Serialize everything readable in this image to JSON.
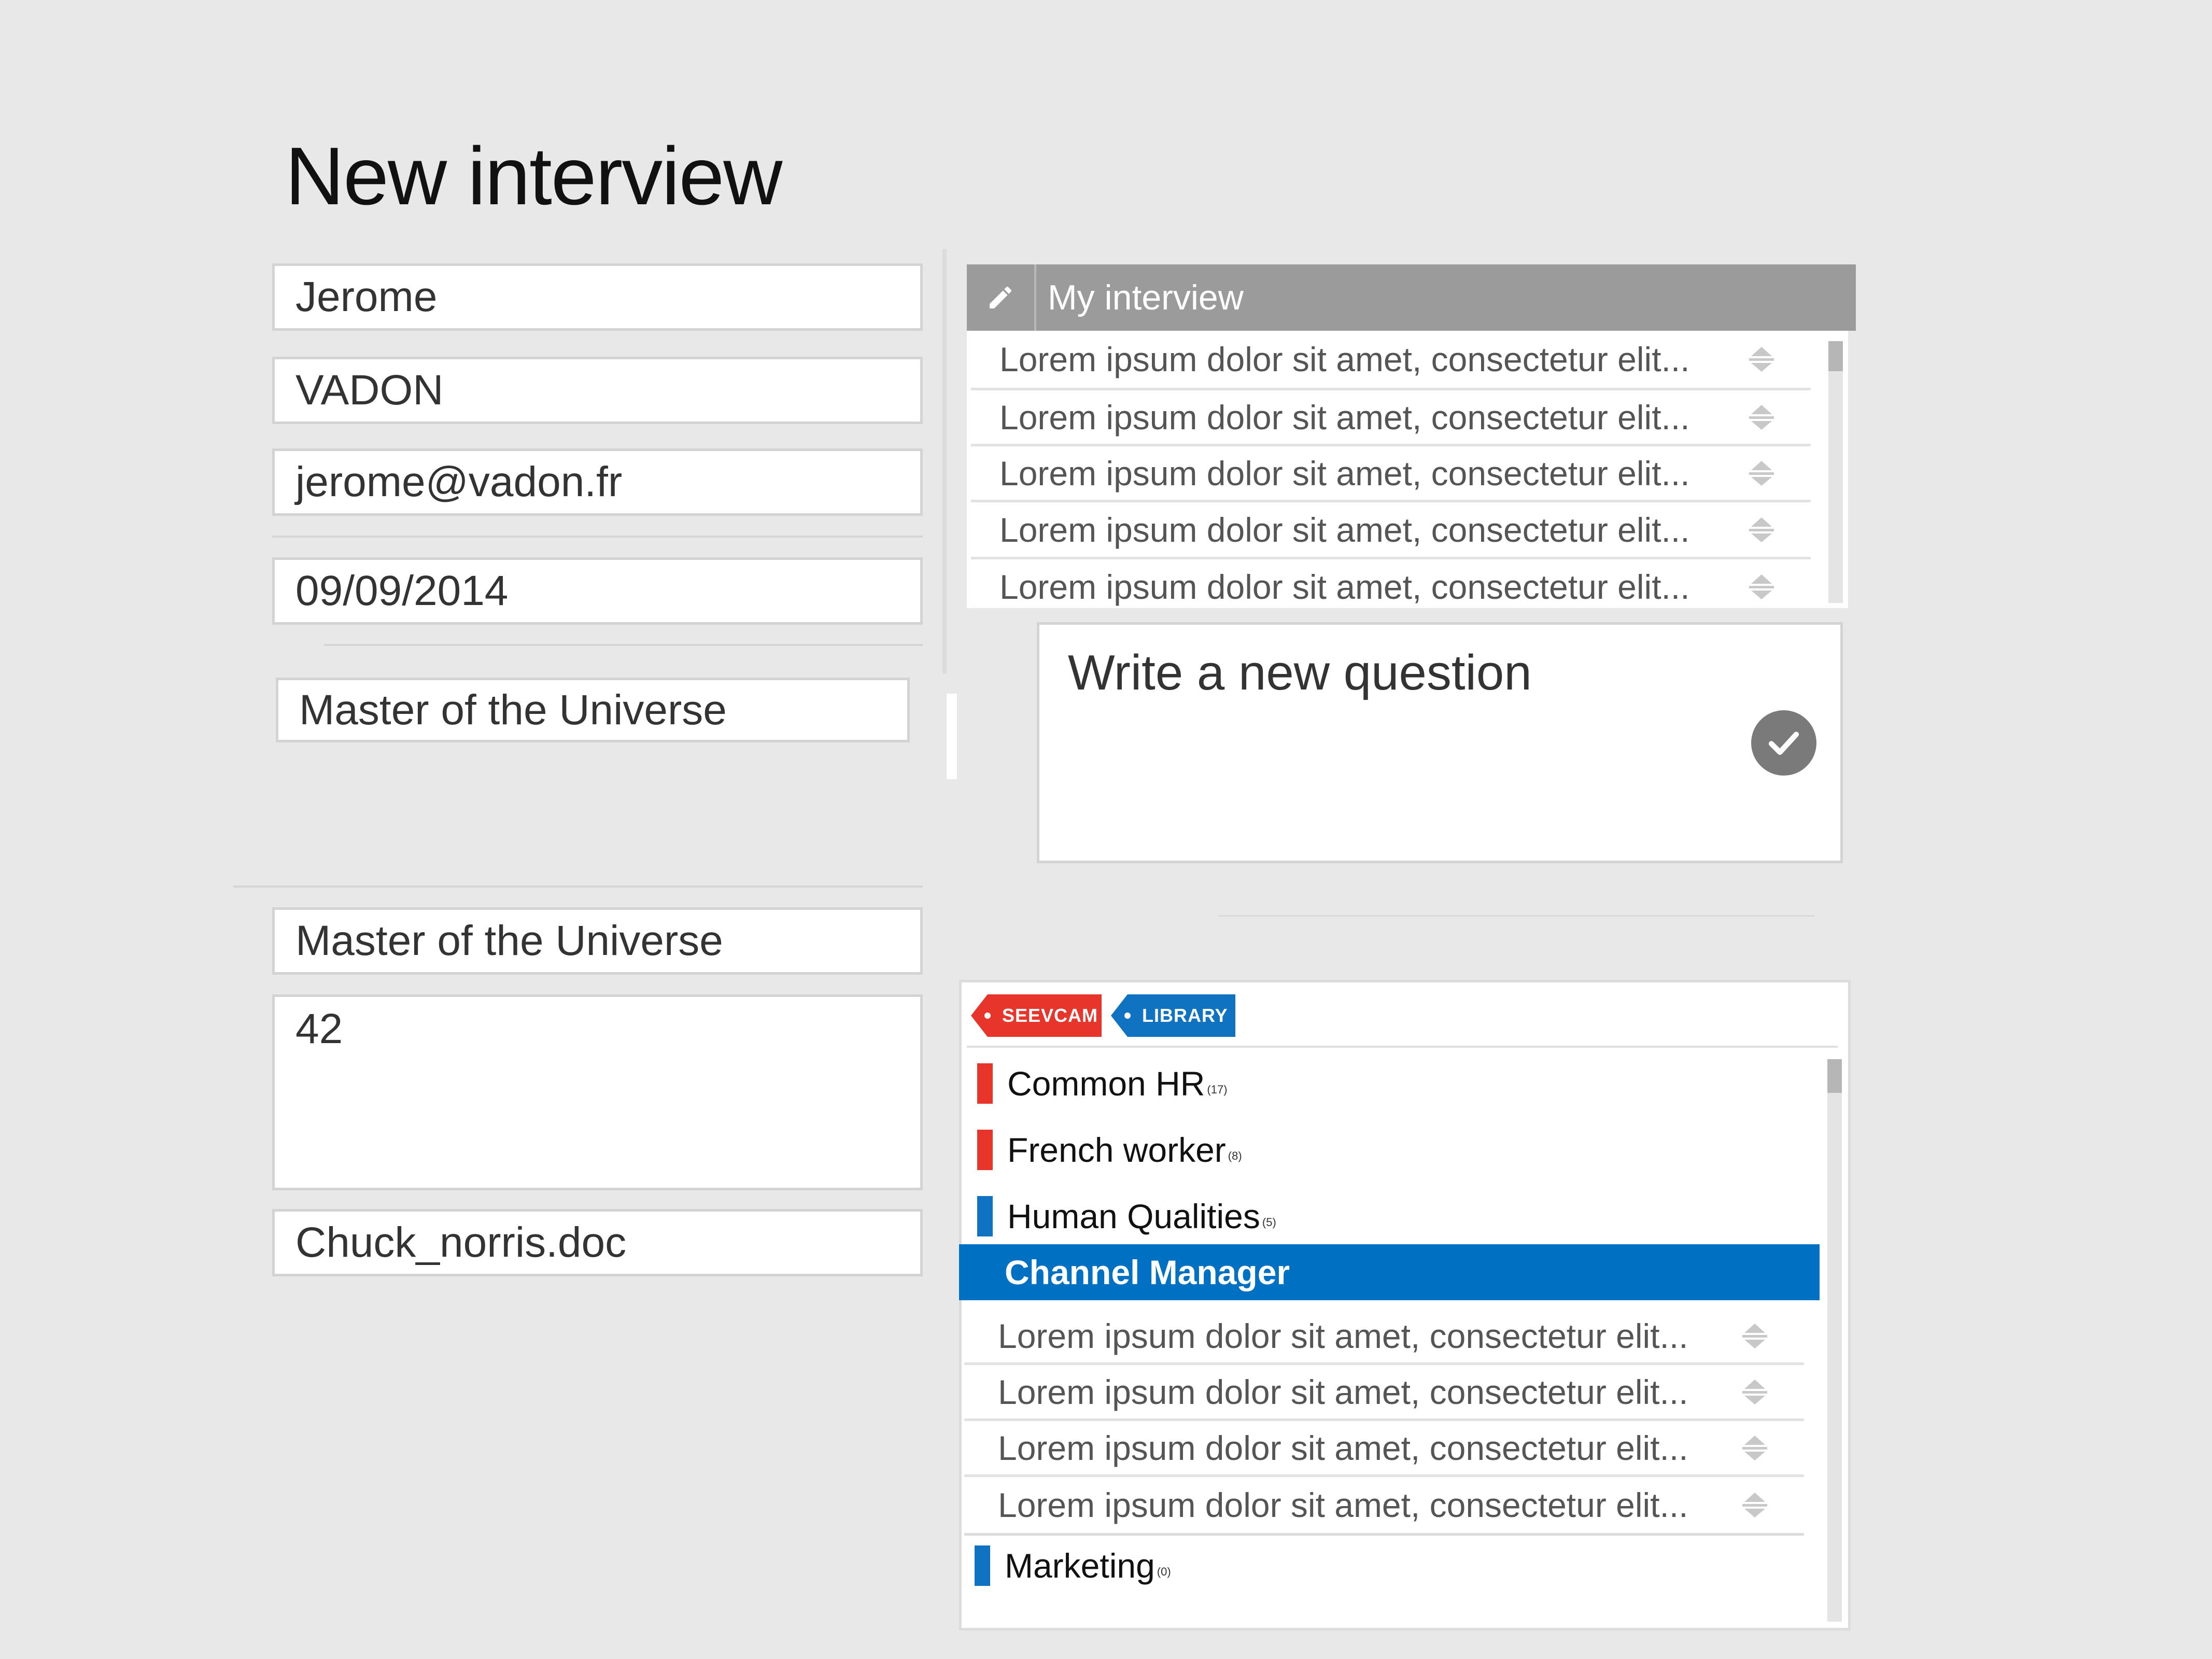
{
  "page": {
    "title": "New interview"
  },
  "form": {
    "first_name": "Jerome",
    "last_name": "VADON",
    "email": "jerome@vadon.fr",
    "date": "09/09/2014",
    "position": "Master of the Universe",
    "position_2": "Master of the Universe",
    "notes": "42",
    "attachment": "Chuck_norris.doc"
  },
  "interview_panel": {
    "title": "My interview",
    "questions": [
      "Lorem ipsum dolor sit amet, consectetur elit...",
      "Lorem ipsum dolor sit amet, consectetur elit...",
      "Lorem ipsum dolor sit amet, consectetur elit...",
      "Lorem ipsum dolor sit amet, consectetur elit...",
      "Lorem ipsum dolor sit amet, consectetur elit..."
    ]
  },
  "new_question": {
    "placeholder": "Write a new question"
  },
  "library": {
    "tags": [
      {
        "label": "SEEVCAM",
        "color": "#e8352b"
      },
      {
        "label": "LIBRARY",
        "color": "#0f73c2"
      }
    ],
    "categories": [
      {
        "name": "Common HR",
        "count": "(17)",
        "color": "#e8352b"
      },
      {
        "name": "French worker",
        "count": "(8)",
        "color": "#e8352b"
      },
      {
        "name": "Human Qualities",
        "count": "(5)",
        "color": "#0f73c2"
      }
    ],
    "selected_category": "Channel Manager",
    "selected_questions": [
      "Lorem ipsum dolor sit amet, consectetur elit...",
      "Lorem ipsum dolor sit amet, consectetur elit...",
      "Lorem ipsum dolor sit amet, consectetur elit...",
      "Lorem ipsum dolor sit amet, consectetur elit..."
    ],
    "last_category": {
      "name": "Marketing",
      "count": "(0)",
      "color": "#0f73c2"
    }
  },
  "colors": {
    "accent_blue": "#0071c2",
    "tag_red": "#e8352b",
    "header_gray": "#9b9b9b",
    "background": "#e8e8e8"
  },
  "icons": {
    "header": "pencil-icon",
    "reorder": "reorder-arrows-icon",
    "submit": "checkmark-icon"
  }
}
